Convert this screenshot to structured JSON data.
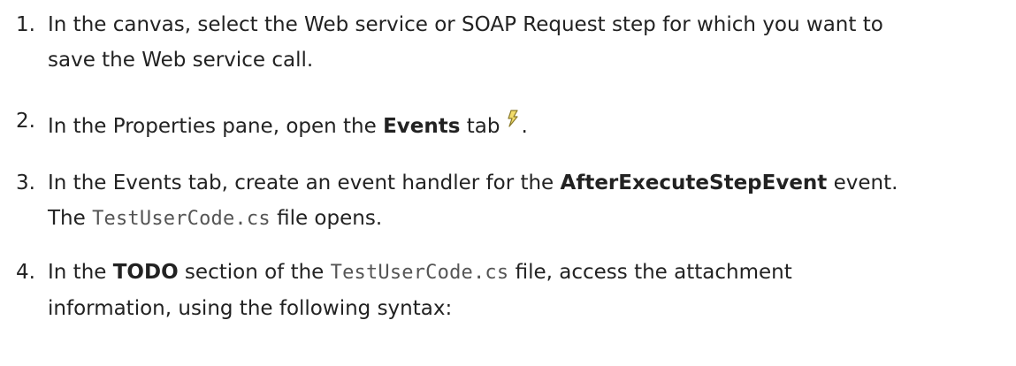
{
  "steps": [
    {
      "number": "1.",
      "line1": "In the canvas, select the Web service or SOAP Request step for which you want to",
      "line2": "save the Web service call."
    },
    {
      "number": "2.",
      "before": "In the Properties pane, open the ",
      "bold": "Events",
      "after": " tab",
      "end": ".",
      "icon": "lightning-bolt-icon"
    },
    {
      "number": "3.",
      "before": "In the Events tab, create an event handler for the ",
      "bold": "AfterExecuteStepEvent",
      "after": " event.",
      "line2_before": "The ",
      "line2_code": "TestUserCode.cs",
      "line2_after": " file opens."
    },
    {
      "number": "4.",
      "before": "In the ",
      "bold": "TODO",
      "middle": " section of the ",
      "code": "TestUserCode.cs",
      "after": " file, access the attachment",
      "line2": "information, using the following syntax:"
    }
  ],
  "colors": {
    "text": "#222222",
    "code": "#555555",
    "icon_fill": "#f2dc6a",
    "icon_stroke": "#8a7a2a"
  }
}
